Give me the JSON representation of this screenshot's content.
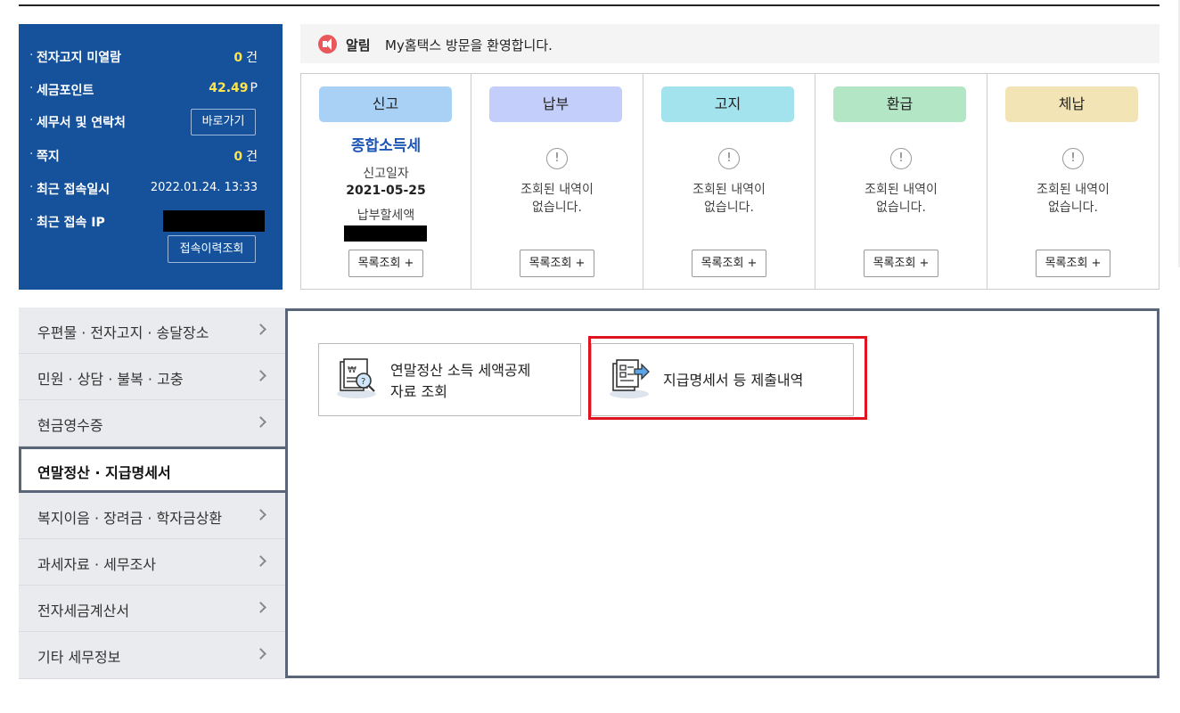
{
  "info_panel": {
    "unread_notice": {
      "label": "전자고지 미열람",
      "value": "0",
      "unit": "건"
    },
    "tax_points": {
      "label": "세금포인트",
      "value": "42.49",
      "unit": "P"
    },
    "tax_office": {
      "label": "세무서 및 연락처",
      "button": "바로가기"
    },
    "messages": {
      "label": "쪽지",
      "value": "0",
      "unit": "건"
    },
    "last_login": {
      "label": "최근 접속일시",
      "value": "2022.01.24.  13:33"
    },
    "last_ip": {
      "label": "최근 접속 IP",
      "button": "접속이력조회"
    }
  },
  "notice": {
    "label": "알림",
    "text": "My홈택스 방문을 환영합니다."
  },
  "cards": [
    {
      "title": "신고",
      "color": "#a9d0f5",
      "tax_name": "종합소득세",
      "date_label": "신고일자",
      "date": "2021-05-25",
      "amount_label": "납부할세액",
      "button": "목록조회 +"
    },
    {
      "title": "납부",
      "color": "#c3cffa",
      "empty_icon": "!",
      "empty_text_1": "조회된 내역이",
      "empty_text_2": "없습니다.",
      "button": "목록조회 +"
    },
    {
      "title": "고지",
      "color": "#a3e3ee",
      "empty_icon": "!",
      "empty_text_1": "조회된 내역이",
      "empty_text_2": "없습니다.",
      "button": "목록조회 +"
    },
    {
      "title": "환급",
      "color": "#b2e6c4",
      "empty_icon": "!",
      "empty_text_1": "조회된 내역이",
      "empty_text_2": "없습니다.",
      "button": "목록조회 +"
    },
    {
      "title": "체납",
      "color": "#f3e4b6",
      "empty_icon": "!",
      "empty_text_1": "조회된 내역이",
      "empty_text_2": "없습니다.",
      "button": "목록조회 +"
    }
  ],
  "side_menu": [
    {
      "label": "우편물 · 전자고지 · 송달장소"
    },
    {
      "label": "민원 · 상담 · 불복 · 고충"
    },
    {
      "label": "현금영수증"
    },
    {
      "label": "연말정산 · 지급명세서",
      "active": true
    },
    {
      "label": "복지이음 · 장려금 · 학자금상환"
    },
    {
      "label": "과세자료 · 세무조사"
    },
    {
      "label": "전자세금계산서"
    },
    {
      "label": "기타 세무정보"
    }
  ],
  "services": [
    {
      "line1": "연말정산 소득 세액공제",
      "line2": "자료 조회",
      "icon": "document-search-icon"
    },
    {
      "line1": "지급명세서 등 제출내역",
      "icon": "document-submit-icon"
    }
  ]
}
